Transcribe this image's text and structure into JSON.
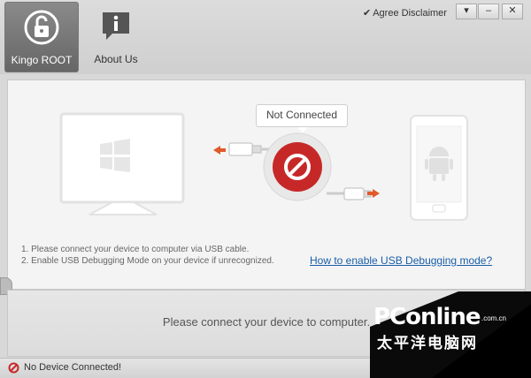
{
  "tabs": [
    {
      "label": "Kingo ROOT",
      "icon": "unlock-icon",
      "active": true
    },
    {
      "label": "About Us",
      "icon": "info-bubble-icon",
      "active": false
    }
  ],
  "titlebar": {
    "agree_label": "Agree Disclaimer",
    "agree_checked": true
  },
  "connection": {
    "status": "Not Connected"
  },
  "instructions": {
    "line1": "1. Please connect your device to computer via USB cable.",
    "line2": "2. Enable USB Debugging Mode on your device if unrecognized."
  },
  "help_link": "How to enable USB Debugging mode?",
  "main_message": "Please connect your device to computer.",
  "status_bar": {
    "text": "No Device Connected!"
  },
  "watermark": {
    "brand": "PConline",
    "domain": ".com.cn",
    "chinese": "太平洋电脑网"
  },
  "colors": {
    "accent_red": "#c62828",
    "link_blue": "#1a5ea8",
    "arrow_orange": "#e05a2a"
  }
}
